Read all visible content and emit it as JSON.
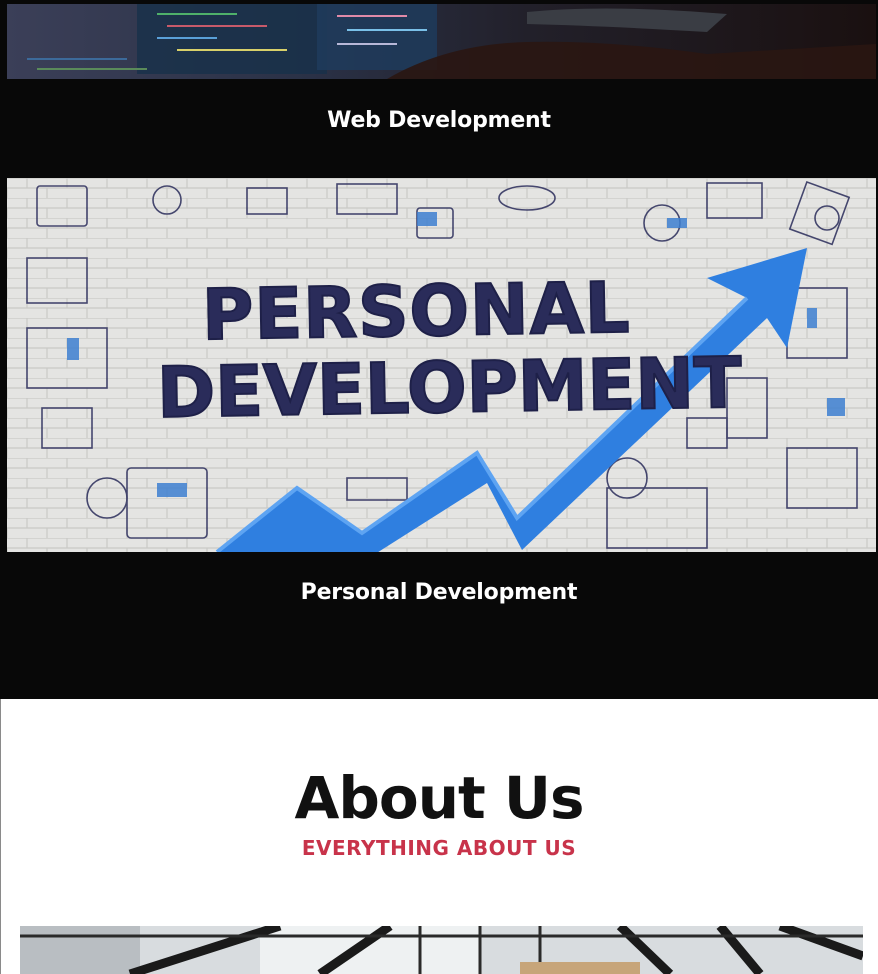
{
  "services": [
    {
      "title": "Web Development",
      "image": "coding-screen-photo"
    },
    {
      "title": "Personal Development",
      "image": "personal-development-chalk-wall-photo",
      "image_text": [
        "PERSONAL",
        "DEVELOPMENT"
      ]
    }
  ],
  "about": {
    "heading": "About Us",
    "subheading": "EVERYTHING ABOUT US",
    "image": "office-interior-photo"
  },
  "colors": {
    "dark_bg": "#080808",
    "accent": "#c8334a",
    "arrow_blue": "#2f7fe0",
    "ink": "#2a2c5a"
  }
}
